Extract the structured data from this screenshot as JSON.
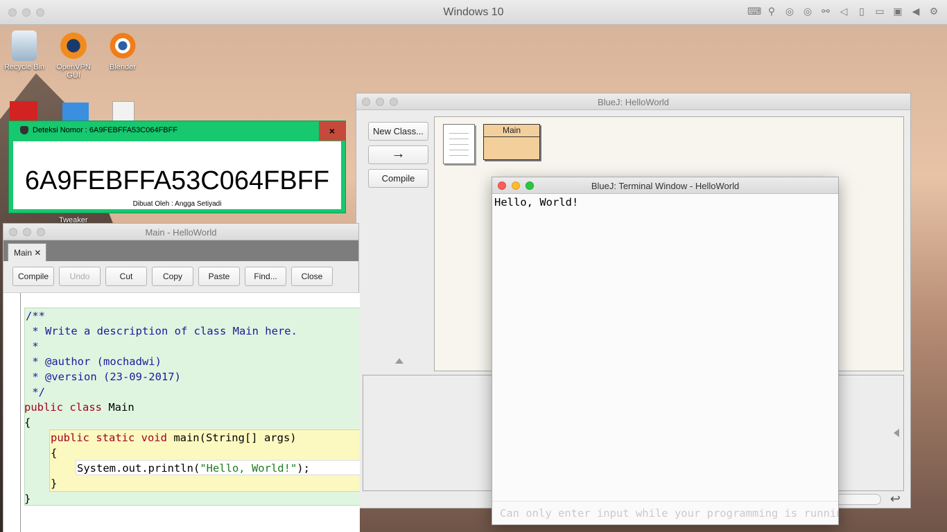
{
  "host": {
    "title": "Windows 10",
    "toolbar_icons": [
      "keyboard-icon",
      "usb-icon",
      "disc-icon",
      "disc-icon",
      "network-icon",
      "audio-icon",
      "phone-icon",
      "display-icon",
      "display-icon",
      "play-icon",
      "gear-icon"
    ]
  },
  "desktop": {
    "icons": [
      {
        "label": "Recycle Bin",
        "icon": "recycle-bin-icon"
      },
      {
        "label": "OpenVPN GUI",
        "icon": "openvpn-icon"
      },
      {
        "label": "Blender",
        "icon": "blender-icon"
      }
    ],
    "tweaker_label": "Tweaker"
  },
  "deteksi": {
    "title": "Deteksi Nomor : 6A9FEBFFA53C064FBFF",
    "close": "×",
    "serial": "6A9FEBFFA53C064FBFF",
    "credit": "Dibuat Oleh : Angga Setiyadi"
  },
  "editor": {
    "title": "Main - HelloWorld",
    "tab": "Main ✕",
    "buttons": {
      "compile": "Compile",
      "undo": "Undo",
      "cut": "Cut",
      "copy": "Copy",
      "paste": "Paste",
      "find": "Find...",
      "close": "Close"
    },
    "code": {
      "l1": "/**",
      "l2": " * Write a description of class Main here.",
      "l3": " *",
      "l4": " * @author (mochadwi)",
      "l5": " * @version (23-09-2017)",
      "l6": " */",
      "l7_kw1": "public ",
      "l7_kw2": "class ",
      "l7_name": "Main",
      "l8": "{",
      "l9_kw": "public static void ",
      "l9_rest": "main(String[] args)",
      "l10": "{",
      "l11_a": "System.out.println(",
      "l11_str": "\"Hello, World!\"",
      "l11_b": ");",
      "l12": "}",
      "l13": "}"
    }
  },
  "bluej": {
    "title": "BlueJ:  HelloWorld",
    "new_class": "New Class...",
    "arrow": "→",
    "compile": "Compile",
    "class_name": "Main"
  },
  "terminal": {
    "title": "BlueJ: Terminal Window - HelloWorld",
    "output": "Hello, World!",
    "input_placeholder": "Can only enter input while your programming is running"
  },
  "colors": {
    "deteksi_green": "#16c86e",
    "class_box": "#f3cf9b",
    "class_scope": "#e0f5e0",
    "method_scope": "#fbf8c0"
  }
}
